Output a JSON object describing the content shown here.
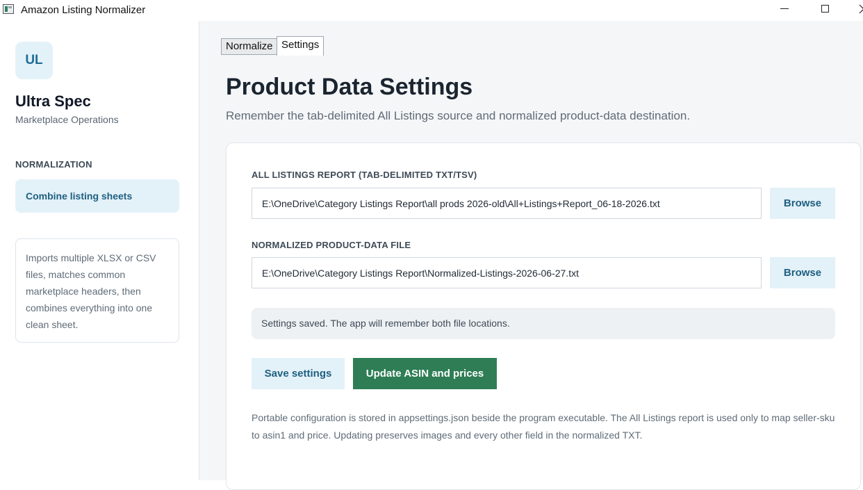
{
  "window": {
    "title": "Amazon Listing Normalizer"
  },
  "sidebar": {
    "logo_initials": "UL",
    "company_name": "Ultra Spec",
    "company_subtitle": "Marketplace Operations",
    "section_label": "NORMALIZATION",
    "nav_items": [
      {
        "label": "Combine listing sheets",
        "active": true
      }
    ],
    "info_text": "Imports multiple XLSX or CSV files, matches common marketplace headers, then combines everything into one clean sheet."
  },
  "tabs": [
    {
      "label": "Normalize",
      "active": false
    },
    {
      "label": "Settings",
      "active": true
    }
  ],
  "main": {
    "title": "Product Data Settings",
    "subtitle": "Remember the tab-delimited All Listings source and normalized product-data destination.",
    "source": {
      "label": "ALL LISTINGS REPORT (TAB-DELIMITED TXT/TSV)",
      "value": "E:\\OneDrive\\Category Listings Report\\all prods 2026-old\\All+Listings+Report_06-18-2026.txt",
      "browse_label": "Browse"
    },
    "destination": {
      "label": "NORMALIZED PRODUCT-DATA FILE",
      "value": "E:\\OneDrive\\Category Listings Report\\Normalized-Listings-2026-06-27.txt",
      "browse_label": "Browse"
    },
    "status": "Settings saved. The app will remember both file locations.",
    "save_label": "Save settings",
    "update_label": "Update ASIN and prices",
    "footnote": "Portable configuration is stored in appsettings.json beside the program executable. The All Listings report is used only to map seller-sku to asin1 and price. Updating preserves images and every other field in the normalized TXT."
  },
  "colors": {
    "accent": "#1e5f80",
    "accent_bg": "#e3f1f8",
    "primary_button": "#2e7d55"
  }
}
